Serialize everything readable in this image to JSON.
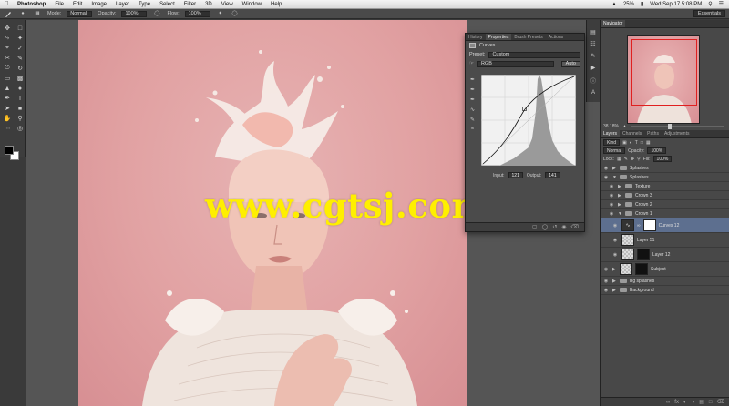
{
  "menubar": {
    "app": "Photoshop",
    "items": [
      "File",
      "Edit",
      "Image",
      "Layer",
      "Type",
      "Select",
      "Filter",
      "3D",
      "View",
      "Window",
      "Help"
    ],
    "battery": "25%",
    "clock": "Wed Sep 17 5:08 PM"
  },
  "options": {
    "mode_label": "Mode:",
    "mode_value": "Normal",
    "opacity_label": "Opacity:",
    "opacity_value": "100%",
    "flow_label": "Flow:",
    "flow_value": "100%",
    "workspace": "Essentials"
  },
  "canvas": {
    "watermark": "www.cgtsj.com"
  },
  "properties": {
    "tabs": [
      "History",
      "Properties",
      "Brush Presets",
      "Actions"
    ],
    "active_tab": "Properties",
    "title": "Curves",
    "preset_label": "Preset:",
    "preset_value": "Custom",
    "channel_value": "RGB",
    "auto_label": "Auto",
    "input_label": "Input:",
    "input_value": "121",
    "output_label": "Output:",
    "output_value": "141"
  },
  "navigator": {
    "tabs": [
      "Navigator"
    ],
    "zoom": "38.18%"
  },
  "layers_panel": {
    "tabs": [
      "Layers",
      "Channels",
      "Paths",
      "Adjustments"
    ],
    "filter_label": "Kind",
    "blend_mode": "Normal",
    "opacity_label": "Opacity:",
    "opacity_value": "100%",
    "lock_label": "Lock:",
    "fill_label": "Fill:",
    "fill_value": "100%",
    "layers": [
      {
        "name": "Splashes",
        "kind": "group",
        "indent": 0,
        "selected": false
      },
      {
        "name": "Splashes",
        "kind": "group",
        "indent": 0,
        "selected": false
      },
      {
        "name": "Texture",
        "kind": "group",
        "indent": 1,
        "selected": false
      },
      {
        "name": "Crown 3",
        "kind": "group",
        "indent": 1,
        "selected": false
      },
      {
        "name": "Crown 2",
        "kind": "group",
        "indent": 1,
        "selected": false
      },
      {
        "name": "Crown 1",
        "kind": "group",
        "indent": 1,
        "selected": false
      },
      {
        "name": "Curves 12",
        "kind": "adjustment",
        "indent": 2,
        "selected": true
      },
      {
        "name": "Layer 51",
        "kind": "pixel",
        "indent": 2,
        "selected": false
      },
      {
        "name": "Layer 12",
        "kind": "masked",
        "indent": 2,
        "selected": false
      },
      {
        "name": "Subject",
        "kind": "masked",
        "indent": 0,
        "selected": false
      },
      {
        "name": "Bg splashes",
        "kind": "group",
        "indent": 0,
        "selected": false
      },
      {
        "name": "Background",
        "kind": "group",
        "indent": 0,
        "selected": false
      }
    ]
  }
}
